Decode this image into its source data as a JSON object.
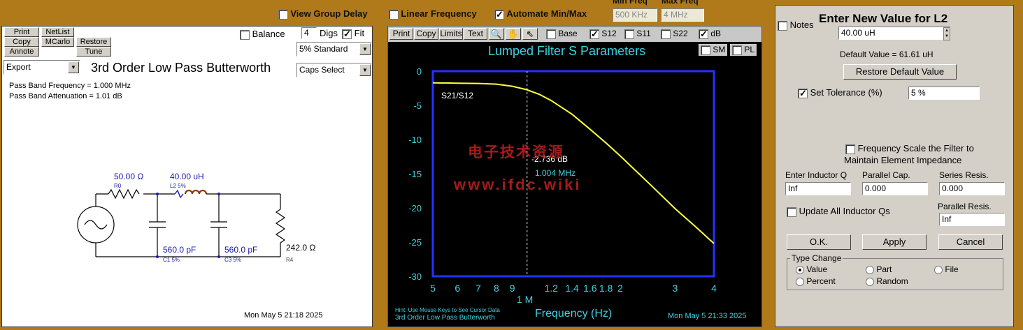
{
  "topbar": {
    "view_group_delay": "View Group Delay",
    "linear_frequency": "Linear Frequency",
    "automate_minmax": "Automate Min/Max",
    "min_freq_label": "Min Freq",
    "max_freq_label": "Max Freq",
    "min_freq_value": "500 KHz",
    "max_freq_value": "4 MHz"
  },
  "left": {
    "buttons": [
      "Print",
      "NetList",
      "Copy",
      "MCarlo",
      "Restore",
      "Annote",
      "Tune"
    ],
    "balance": "Balance",
    "digs_value": "4",
    "digs_label": "Digs",
    "fit_label": "Fit",
    "tolerance_select": "5% Standard",
    "export_select": "Export",
    "caps_select": "Caps Select",
    "title": "3rd Order Low Pass Butterworth",
    "info1": "Pass Band Frequency = 1.000 MHz",
    "info2": "Pass Band Attenuation = 1.01 dB",
    "timestamp": "Mon May  5 21:18 2025",
    "schematic": {
      "r0_value": "50.00 Ω",
      "r0_name": "R0",
      "l2_value": "40.00 uH",
      "l2_name": "L2  5%",
      "c1_value": "560.0 pF",
      "c1_name": "C1  5%",
      "c3_value": "560.0 pF",
      "c3_name": "C3  5%",
      "r4_value": "242.0 Ω",
      "r4_name": "R4"
    }
  },
  "chart_panel": {
    "toolbar": [
      "Print",
      "Copy",
      "Limits",
      "Text"
    ],
    "base": "Base",
    "s12": "S12",
    "s11": "S11",
    "s22": "S22",
    "db": "dB",
    "sm": "SM",
    "pl": "PL",
    "title": "Lumped Filter S Parameters",
    "series_label": "S21/S12",
    "cursor_db": "-2.736 dB",
    "cursor_freq": "1.004 MHz",
    "watermark1": "电子技术资源",
    "watermark2": "www.ifdc.wiki",
    "xlabel": "Frequency (Hz)",
    "x_major": "1 M",
    "hint": "Hint: Use Mouse Keys to See Cursor Data",
    "footer_title": "3rd Order Low Pass Butterworth",
    "timestamp": "Mon May  5 21:33 2025"
  },
  "chart_data": {
    "type": "line",
    "title": "Lumped Filter S Parameters",
    "xlabel": "Frequency (Hz)",
    "ylabel": "",
    "xscale": "log",
    "xlim": [
      500000,
      4000000
    ],
    "ylim": [
      -30,
      0
    ],
    "yticks": [
      "0",
      "-5",
      "-10",
      "-15",
      "-20",
      "-25",
      "-30"
    ],
    "xticks": [
      "5",
      "6",
      "7",
      "8",
      "9",
      "1.2",
      "1.4",
      "1.6",
      "1.8",
      "2",
      "3",
      "4"
    ],
    "series": [
      {
        "name": "S21/S12",
        "color": "#ffff40",
        "x": [
          500000,
          600000,
          700000,
          800000,
          900000,
          1000000,
          1100000,
          1200000,
          1400000,
          1600000,
          1800000,
          2000000,
          2500000,
          3000000,
          3500000,
          4000000
        ],
        "y": [
          -1.7,
          -1.75,
          -1.8,
          -1.9,
          -2.2,
          -2.7,
          -3.4,
          -4.3,
          -6.3,
          -8.5,
          -10.5,
          -12.4,
          -16.6,
          -20.1,
          -22.8,
          -25.2
        ]
      }
    ],
    "cursor": {
      "x": 1004000,
      "y": -2.736
    }
  },
  "dialog": {
    "notes": "Notes",
    "title": "Enter New Value for L2",
    "value": "40.00 uH",
    "default_value": "Default Value = 61.61 uH",
    "restore_default": "Restore Default Value",
    "set_tolerance": "Set Tolerance (%)",
    "tolerance_value": "5 %",
    "freq_scale_1": "Frequency Scale the Filter to",
    "freq_scale_2": "Maintain Element Impedance",
    "inductor_q_label": "Enter Inductor Q",
    "inductor_q_value": "Inf",
    "parallel_cap_label": "Parallel Cap.",
    "parallel_cap_value": "0.000",
    "series_res_label": "Series Resis.",
    "series_res_value": "0.000",
    "update_all": "Update All Inductor Qs",
    "parallel_res_label": "Parallel Resis.",
    "parallel_res_value": "Inf",
    "ok": "O.K.",
    "apply": "Apply",
    "cancel": "Cancel",
    "type_change": "Type Change",
    "radio_value": "Value",
    "radio_part": "Part",
    "radio_file": "File",
    "radio_percent": "Percent",
    "radio_random": "Random"
  }
}
